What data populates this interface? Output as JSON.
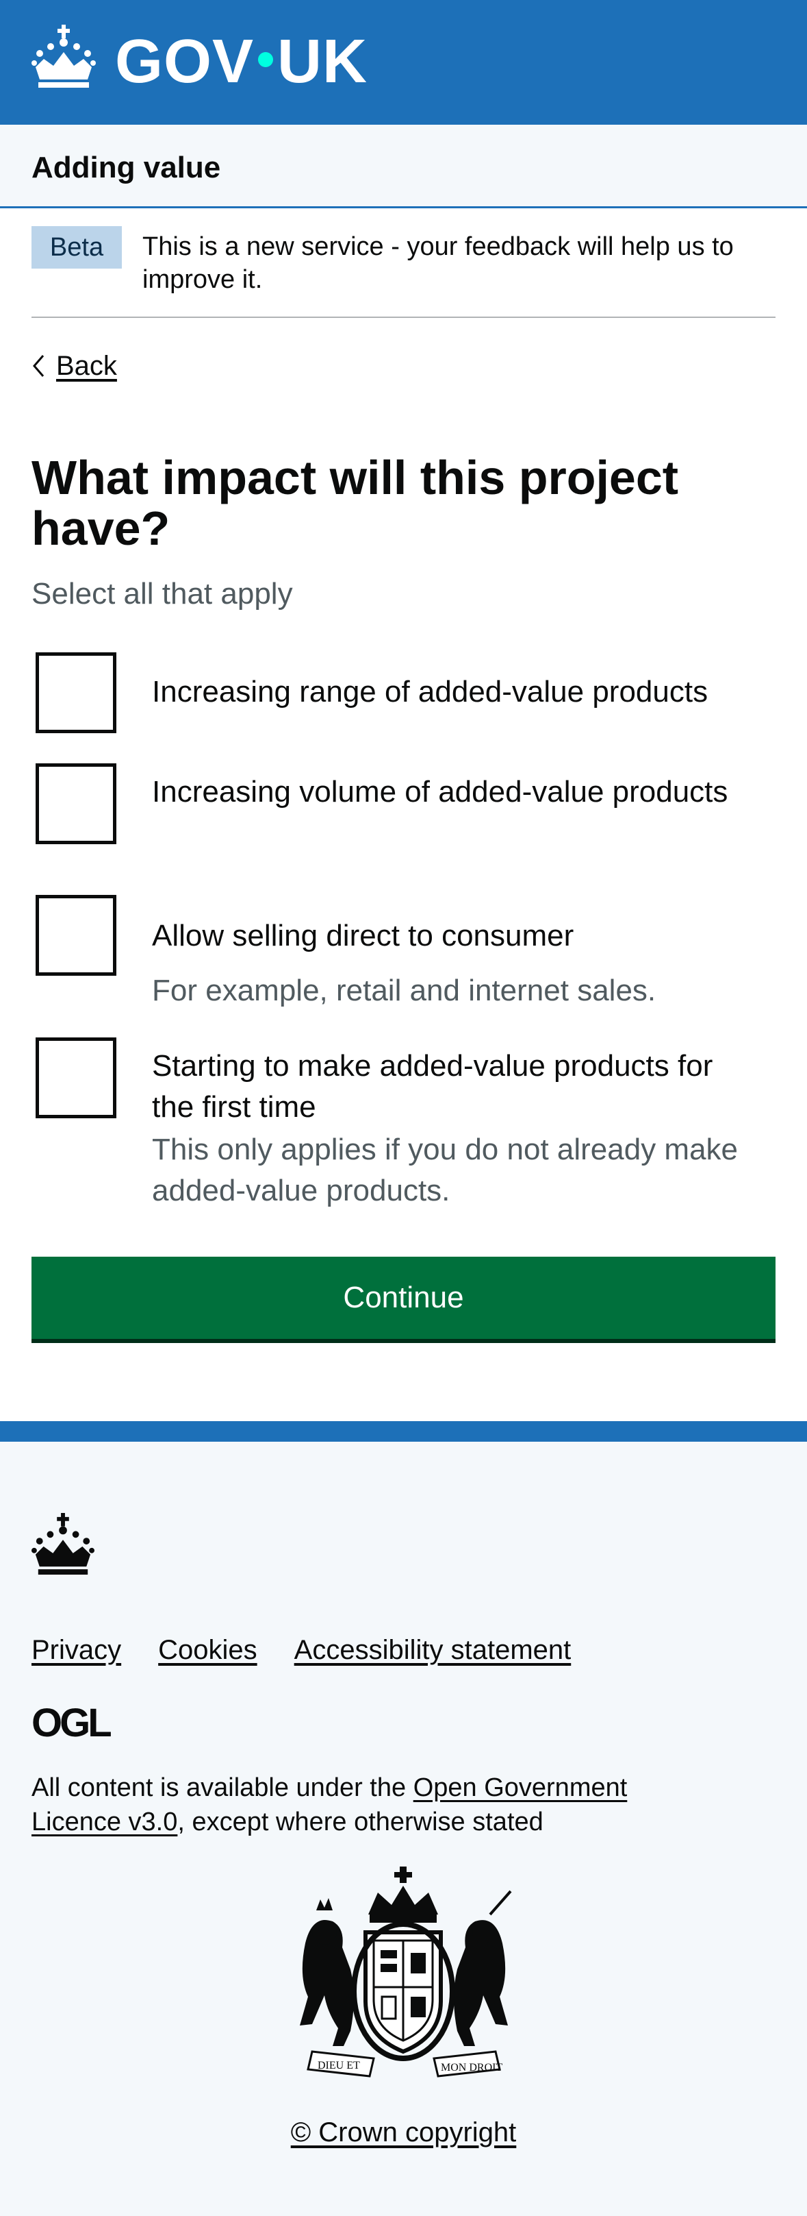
{
  "header": {
    "wordmark_left": "GOV",
    "wordmark_right": "UK",
    "logo_icon": "crown-icon",
    "brand_color": "#1d70b8",
    "dot_color": "#00ffe0"
  },
  "service": {
    "name": "Adding value"
  },
  "phase_banner": {
    "tag": "Beta",
    "text": "This is a new service - your feedback will help us to improve it."
  },
  "back_link": {
    "label": "Back",
    "icon": "chevron-left-icon"
  },
  "question": {
    "heading": "What impact will this project have?",
    "hint": "Select all that apply",
    "options": [
      {
        "label": "Increasing range of added-value products",
        "hint": "",
        "checked": false
      },
      {
        "label": "Increasing volume of added-value products",
        "hint": "",
        "checked": false
      },
      {
        "label": "Allow selling direct to consumer",
        "hint": "For example, retail and internet sales.",
        "checked": false
      },
      {
        "label": "Starting to make added-value products for the first time",
        "hint": "This only applies if you do not already make added-value products.",
        "checked": false
      }
    ]
  },
  "continue_button": {
    "label": "Continue",
    "color": "#00703c"
  },
  "footer": {
    "links": [
      "Privacy",
      "Cookies",
      "Accessibility statement"
    ],
    "ogl_logo_text": "OGL",
    "licence_prefix": "All content is available under the ",
    "licence_link": "Open Government Licence v3.0",
    "licence_suffix": ", except where otherwise stated",
    "copyright": "© Crown copyright",
    "coat_of_arms_icon": "royal-coat-of-arms-icon",
    "motto_left": "DIEU ET",
    "motto_right": "MON DROIT"
  }
}
